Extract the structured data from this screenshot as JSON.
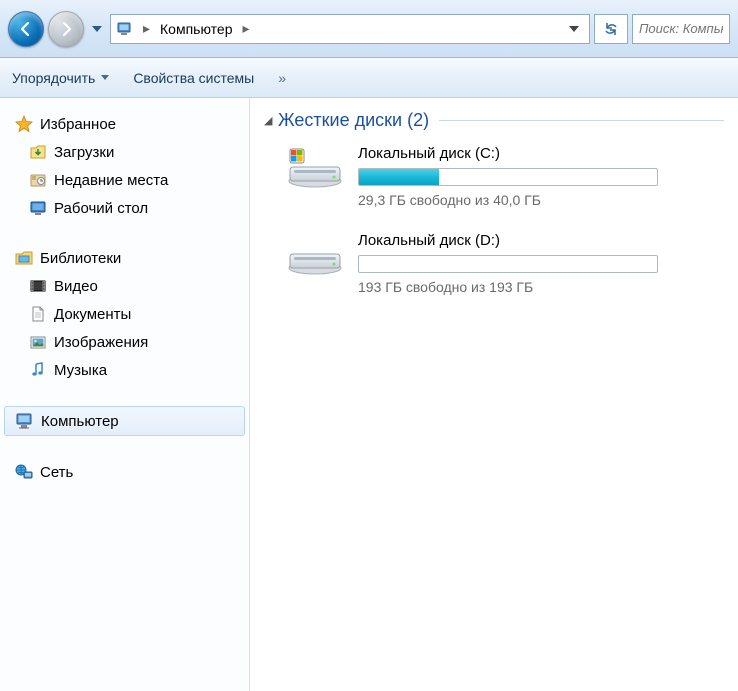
{
  "nav": {
    "address_crumb": "Компьютер",
    "search_placeholder": "Поиск: Компьютер"
  },
  "toolbar": {
    "organize": "Упорядочить",
    "system_props": "Свойства системы",
    "overflow": "»"
  },
  "sidebar": {
    "favorites": {
      "label": "Избранное",
      "items": [
        {
          "label": "Загрузки"
        },
        {
          "label": "Недавние места"
        },
        {
          "label": "Рабочий стол"
        }
      ]
    },
    "libraries": {
      "label": "Библиотеки",
      "items": [
        {
          "label": "Видео"
        },
        {
          "label": "Документы"
        },
        {
          "label": "Изображения"
        },
        {
          "label": "Музыка"
        }
      ]
    },
    "computer": {
      "label": "Компьютер"
    },
    "network": {
      "label": "Сеть"
    }
  },
  "content": {
    "group_title": "Жесткие диски (2)",
    "drives": [
      {
        "name": "Локальный диск (C:)",
        "status": "29,3 ГБ свободно из 40,0 ГБ",
        "fill_percent": 27,
        "system": true
      },
      {
        "name": "Локальный диск (D:)",
        "status": "193 ГБ свободно из 193 ГБ",
        "fill_percent": 0,
        "system": false
      }
    ]
  }
}
